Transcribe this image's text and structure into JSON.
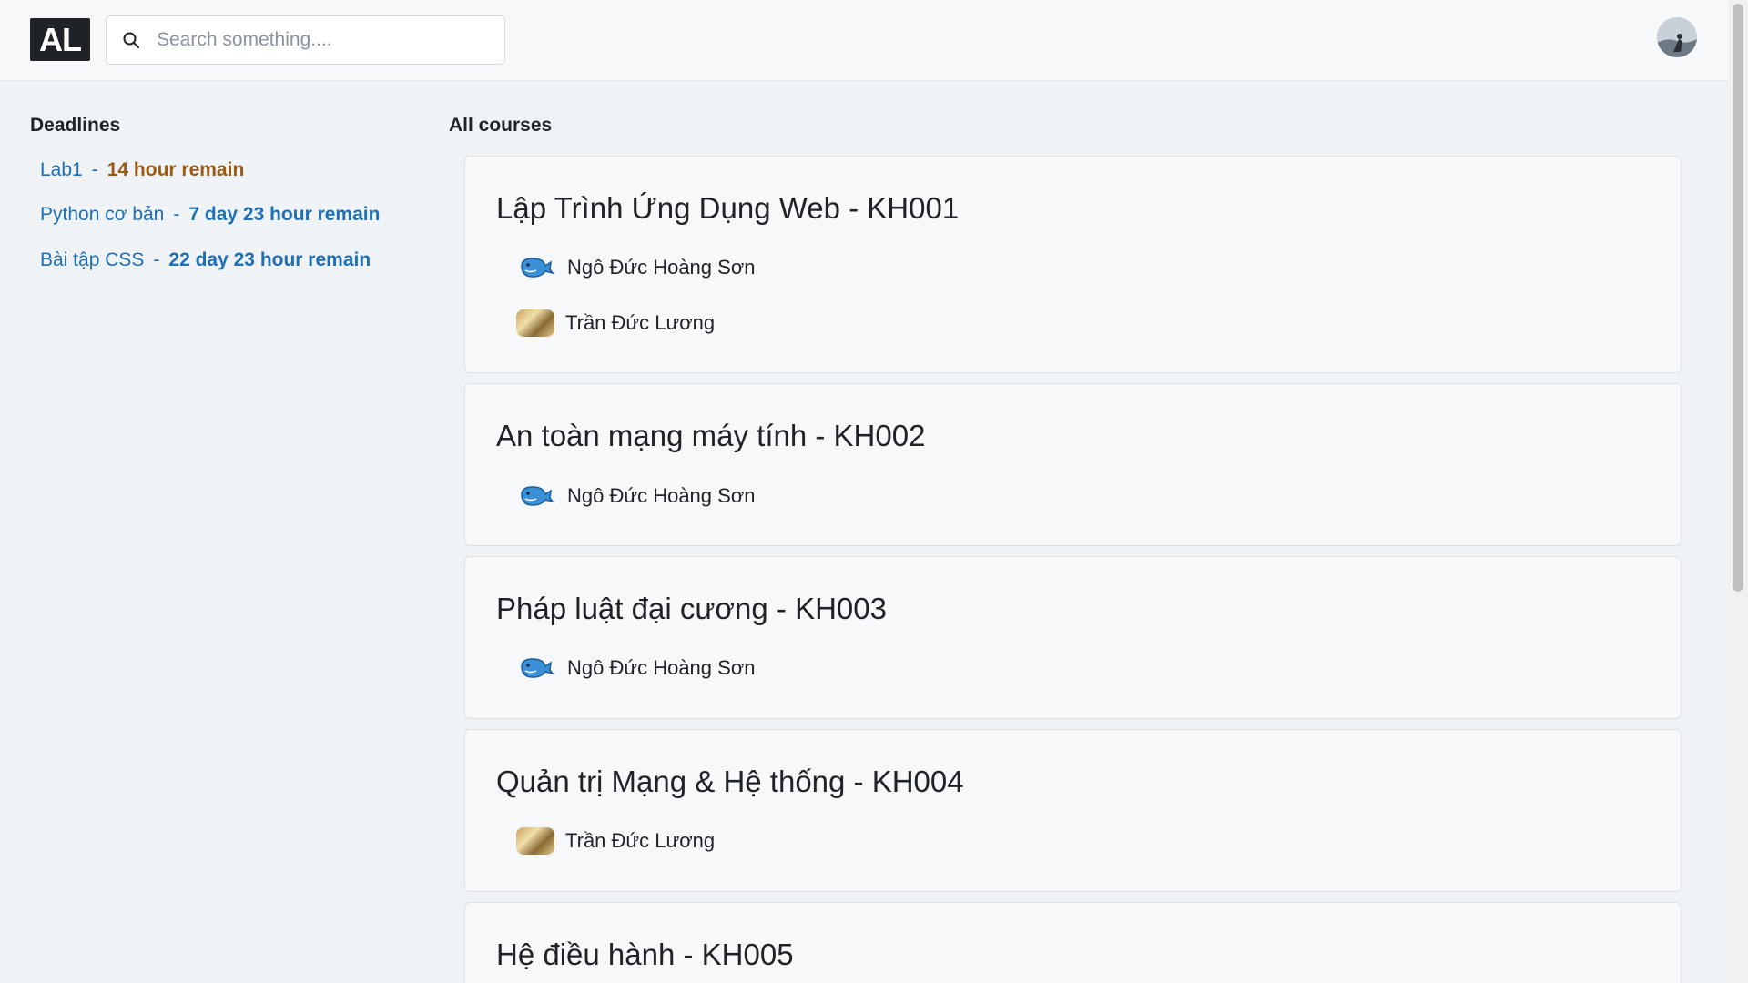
{
  "header": {
    "logo_text": "AL",
    "search": {
      "placeholder": "Search something...."
    }
  },
  "sidebar": {
    "title": "Deadlines",
    "items": [
      {
        "name": "Lab1",
        "separator": "-",
        "remain": "14 hour remain",
        "remain_color": "#9a5a12"
      },
      {
        "name": "Python cơ bản",
        "separator": "-",
        "remain": "7 day 23 hour remain",
        "remain_color": "#1f6fb5"
      },
      {
        "name": "Bài tập CSS",
        "separator": "-",
        "remain": "22 day 23 hour remain",
        "remain_color": "#1f6fb5"
      }
    ]
  },
  "main": {
    "title": "All courses",
    "courses": [
      {
        "title": "Lập Trình Ứng Dụng Web - KH001",
        "teachers": [
          {
            "name": "Ngô Đức Hoàng Sơn",
            "icon": "whale-icon"
          },
          {
            "name": "Trần Đức Lương",
            "icon": "teacher-photo-icon"
          }
        ]
      },
      {
        "title": "An toàn mạng máy tính - KH002",
        "teachers": [
          {
            "name": "Ngô Đức Hoàng Sơn",
            "icon": "whale-icon"
          }
        ]
      },
      {
        "title": "Pháp luật đại cương - KH003",
        "teachers": [
          {
            "name": "Ngô Đức Hoàng Sơn",
            "icon": "whale-icon"
          }
        ]
      },
      {
        "title": "Quản trị Mạng & Hệ thống - KH004",
        "teachers": [
          {
            "name": "Trần Đức Lương",
            "icon": "teacher-photo-icon"
          }
        ]
      },
      {
        "title": "Hệ điều hành - KH005",
        "teachers": []
      }
    ]
  },
  "colors": {
    "accent_blue": "#1f6fb5",
    "urgent_orange": "#9a5a12",
    "background": "#eff3f6"
  }
}
